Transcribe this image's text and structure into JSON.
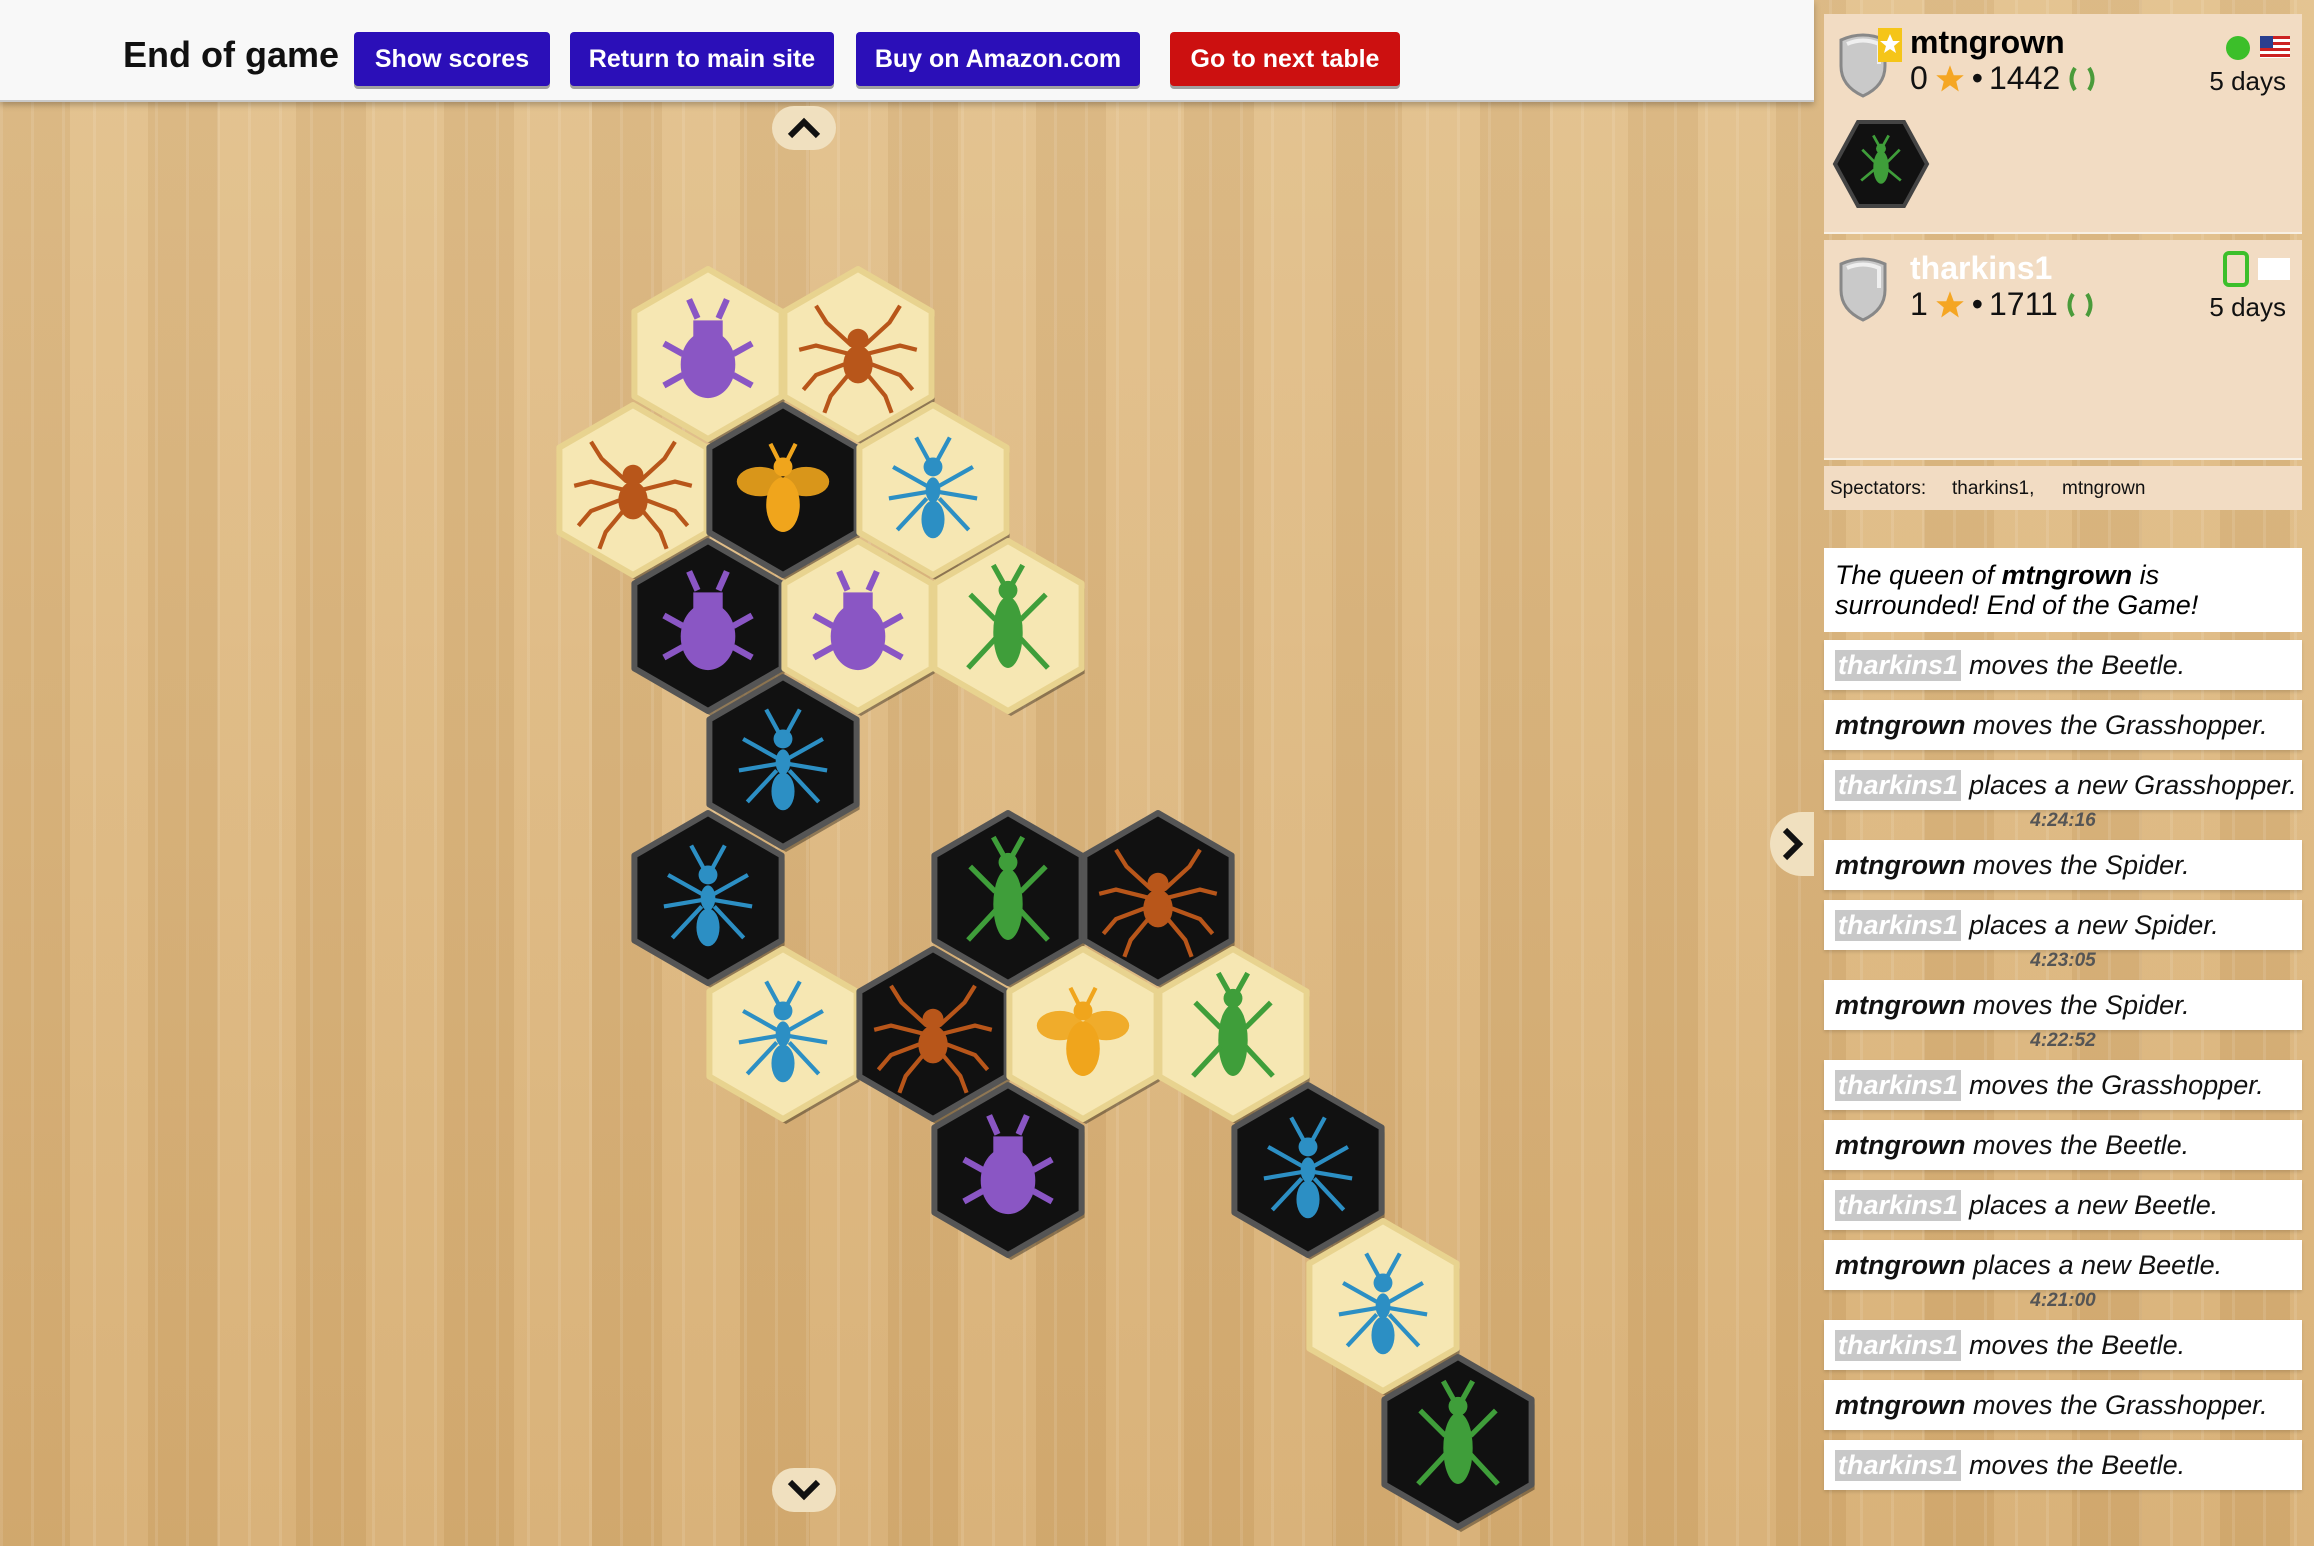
{
  "header": {
    "title": "End of game",
    "buttons": {
      "show_scores": "Show scores",
      "return_main": "Return to main site",
      "buy_amazon": "Buy on Amazon.com",
      "next_table": "Go to next table"
    }
  },
  "players": [
    {
      "name": "mtngrown",
      "stars": "0",
      "rating": "1442",
      "last_seen": "5 days",
      "status": "online",
      "flag": "us-flag",
      "name_color": "#111111"
    },
    {
      "name": "tharkins1",
      "stars": "1",
      "rating": "1711",
      "last_seen": "5 days",
      "status": "mobile",
      "flag": "blank-flag",
      "name_color": "#ffffff"
    }
  ],
  "spectators": {
    "label": "Spectators:",
    "names": [
      "tharkins1,",
      "mtngrown"
    ]
  },
  "log": {
    "end_message_pre": "The queen of ",
    "end_message_name": "mtngrown",
    "end_message_post": " is surrounded! End of the Game!",
    "entries": [
      {
        "player": "tharkins1",
        "action": "moves the Beetle.",
        "style": "pill"
      },
      {
        "player": "mtngrown",
        "action": "moves the Grasshopper.",
        "style": "bold"
      },
      {
        "player": "tharkins1",
        "action": "places a new Grasshopper.",
        "style": "pill"
      },
      {
        "time": "4:24:16"
      },
      {
        "player": "mtngrown",
        "action": "moves the Spider.",
        "style": "bold"
      },
      {
        "player": "tharkins1",
        "action": "places a new Spider.",
        "style": "pill"
      },
      {
        "time": "4:23:05"
      },
      {
        "player": "mtngrown",
        "action": "moves the Spider.",
        "style": "bold"
      },
      {
        "time": "4:22:52"
      },
      {
        "player": "tharkins1",
        "action": "moves the Grasshopper.",
        "style": "pill"
      },
      {
        "player": "mtngrown",
        "action": "moves the Beetle.",
        "style": "bold"
      },
      {
        "player": "tharkins1",
        "action": "places a new Beetle.",
        "style": "pill"
      },
      {
        "player": "mtngrown",
        "action": "places a new Beetle.",
        "style": "bold"
      },
      {
        "time": "4:21:00"
      },
      {
        "player": "tharkins1",
        "action": "moves the Beetle.",
        "style": "pill"
      },
      {
        "player": "mtngrown",
        "action": "moves the Grasshopper.",
        "style": "bold"
      },
      {
        "player": "tharkins1",
        "action": "moves the Beetle.",
        "style": "pill"
      }
    ]
  },
  "colors": {
    "beetle": "#8a56c4",
    "spider": "#b8561a",
    "ant": "#2c8fc4",
    "grasshopper": "#3f9e3a",
    "queen": "#f0a51c",
    "tile_light": "#f6e7b3",
    "tile_dark": "#111111"
  },
  "board": {
    "tiles": [
      {
        "q": 0,
        "r": 0,
        "color": "light",
        "bug": "beetle"
      },
      {
        "q": 1,
        "r": 0,
        "color": "light",
        "bug": "spider"
      },
      {
        "q": -1,
        "r": 1,
        "color": "light",
        "bug": "spider"
      },
      {
        "q": 0,
        "r": 1,
        "color": "dark",
        "bug": "queen"
      },
      {
        "q": 1,
        "r": 1,
        "color": "light",
        "bug": "ant"
      },
      {
        "q": -1,
        "r": 2,
        "color": "dark",
        "bug": "beetle"
      },
      {
        "q": 0,
        "r": 2,
        "color": "light",
        "bug": "beetle"
      },
      {
        "q": 1,
        "r": 2,
        "color": "light",
        "bug": "grasshopper"
      },
      {
        "q": -1,
        "r": 3,
        "color": "dark",
        "bug": "ant"
      },
      {
        "q": -2,
        "r": 4,
        "color": "dark",
        "bug": "ant"
      },
      {
        "q": 0,
        "r": 4,
        "color": "dark",
        "bug": "grasshopper"
      },
      {
        "q": 1,
        "r": 4,
        "color": "dark",
        "bug": "spider"
      },
      {
        "q": -2,
        "r": 5,
        "color": "light",
        "bug": "ant"
      },
      {
        "q": -1,
        "r": 5,
        "color": "dark",
        "bug": "spider"
      },
      {
        "q": 0,
        "r": 5,
        "color": "light",
        "bug": "queen"
      },
      {
        "q": 1,
        "r": 5,
        "color": "light",
        "bug": "grasshopper"
      },
      {
        "q": -1,
        "r": 6,
        "color": "dark",
        "bug": "beetle"
      },
      {
        "q": 1,
        "r": 6,
        "color": "dark",
        "bug": "ant"
      },
      {
        "q": 1,
        "r": 7,
        "color": "light",
        "bug": "ant"
      },
      {
        "q": 1,
        "r": 8,
        "color": "dark",
        "bug": "grasshopper"
      }
    ]
  }
}
